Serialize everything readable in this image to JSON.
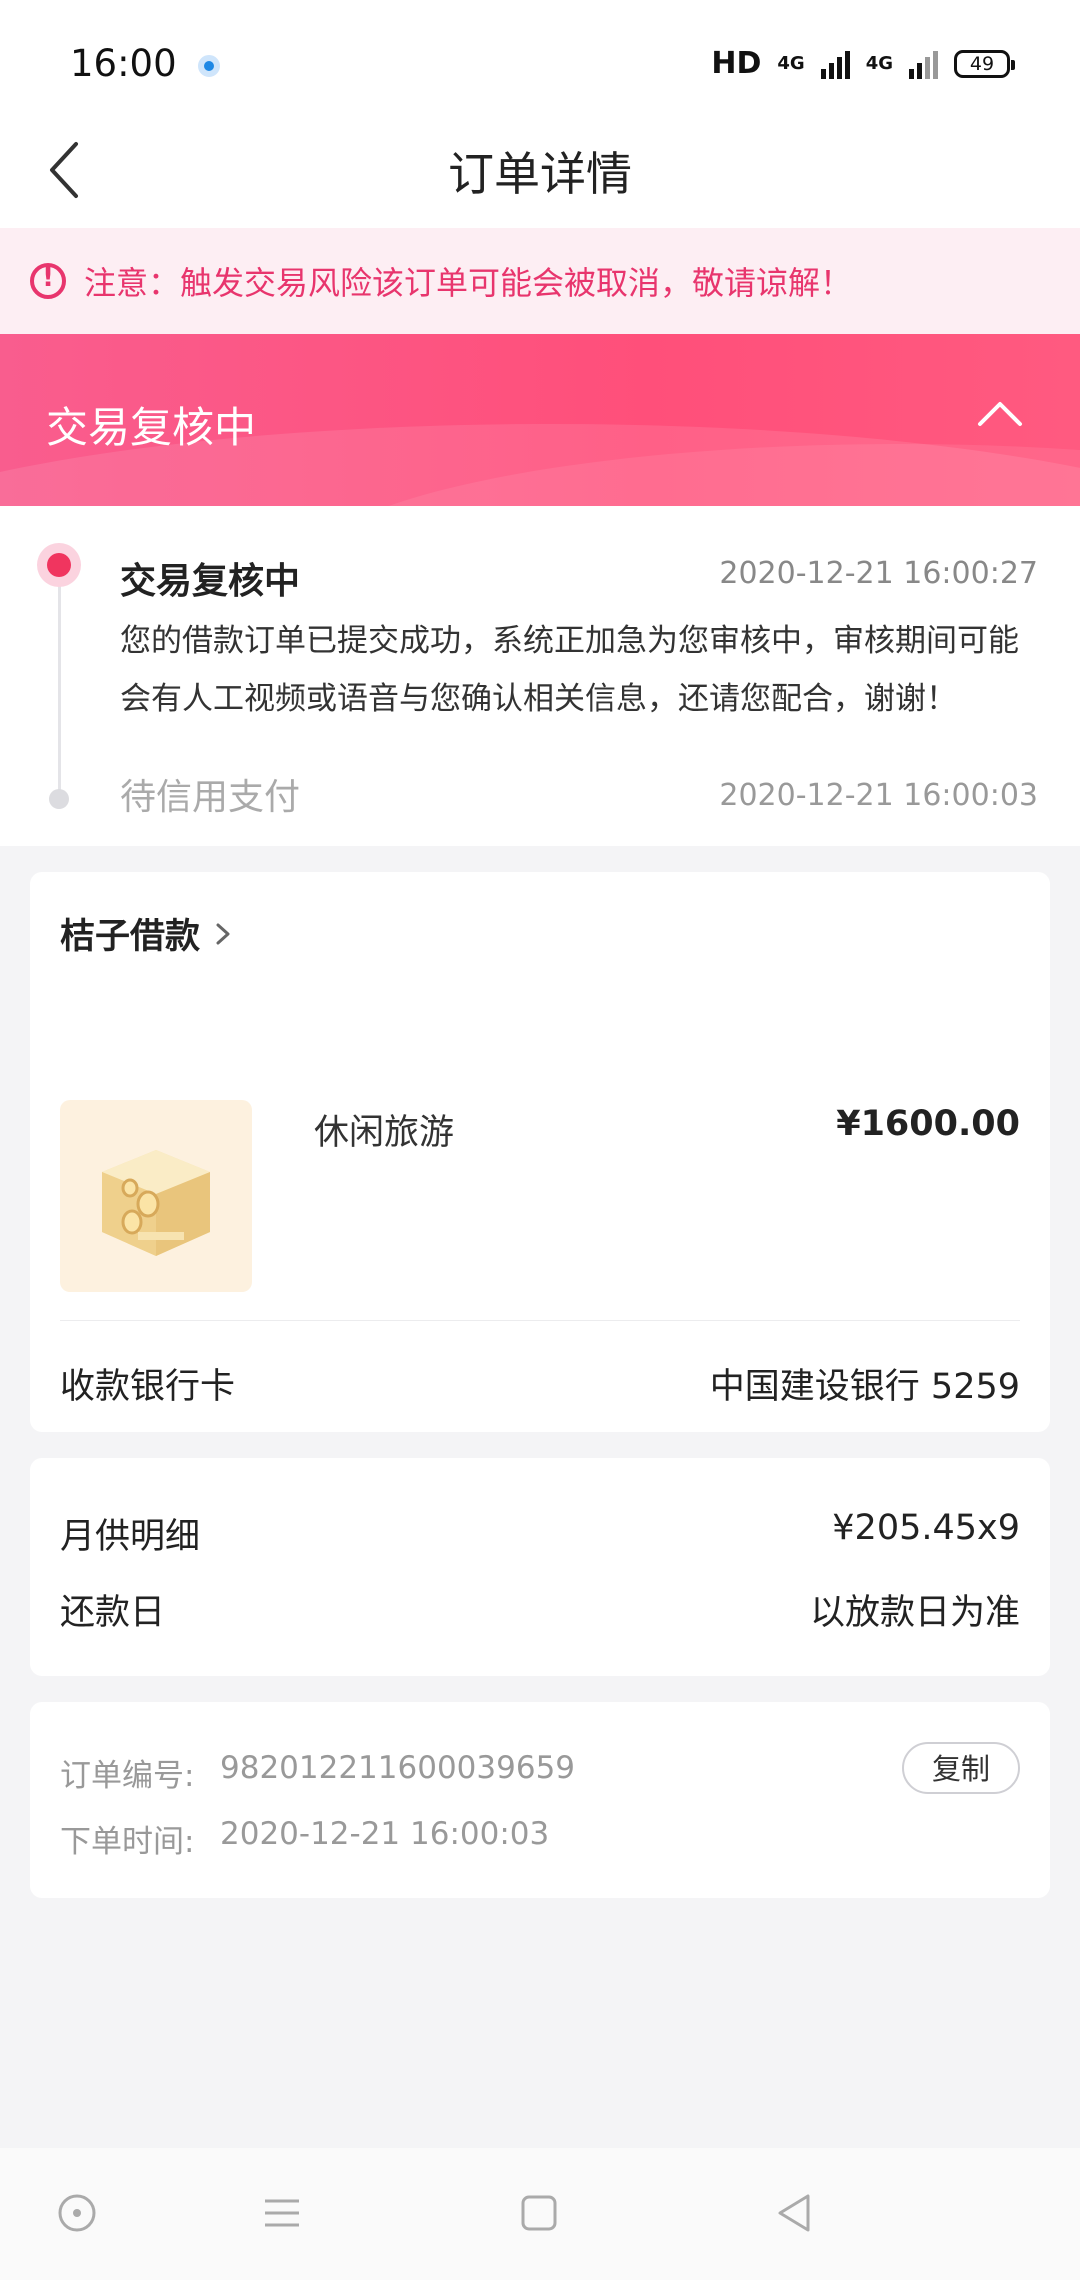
{
  "statusbar": {
    "time": "16:00",
    "network_label": "HD",
    "network1": "4G",
    "network2": "4G",
    "battery": "49"
  },
  "nav": {
    "title": "订单详情"
  },
  "notice": {
    "text": "注意：触发交易风险该订单可能会被取消，敬请谅解！",
    "color": "#e8356d"
  },
  "banner": {
    "title": "交易复核中"
  },
  "timeline": [
    {
      "title": "交易复核中",
      "time": "2020-12-21 16:00:27",
      "desc": "您的借款订单已提交成功，系统正加急为您审核中，审核期间可能会有人工视频或语音与您确认相关信息，还请您配合，谢谢！"
    },
    {
      "title": "待信用支付",
      "time": "2020-12-21 16:00:03"
    }
  ],
  "order": {
    "merchant": "桔子借款",
    "product_name": "休闲旅游",
    "product_price": "¥1600.00",
    "bank_label": "收款银行卡",
    "bank_value": "中国建设银行 5259"
  },
  "repayment": {
    "monthly_label": "月供明细",
    "monthly_value": "¥205.45x9",
    "due_label": "还款日",
    "due_value": "以放款日为准"
  },
  "meta": {
    "order_no_label": "订单编号:",
    "order_no": "982012211600039659",
    "copy_label": "复制",
    "order_time_label": "下单时间:",
    "order_time": "2020-12-21 16:00:03"
  },
  "accent_color": "#ff4f7a"
}
